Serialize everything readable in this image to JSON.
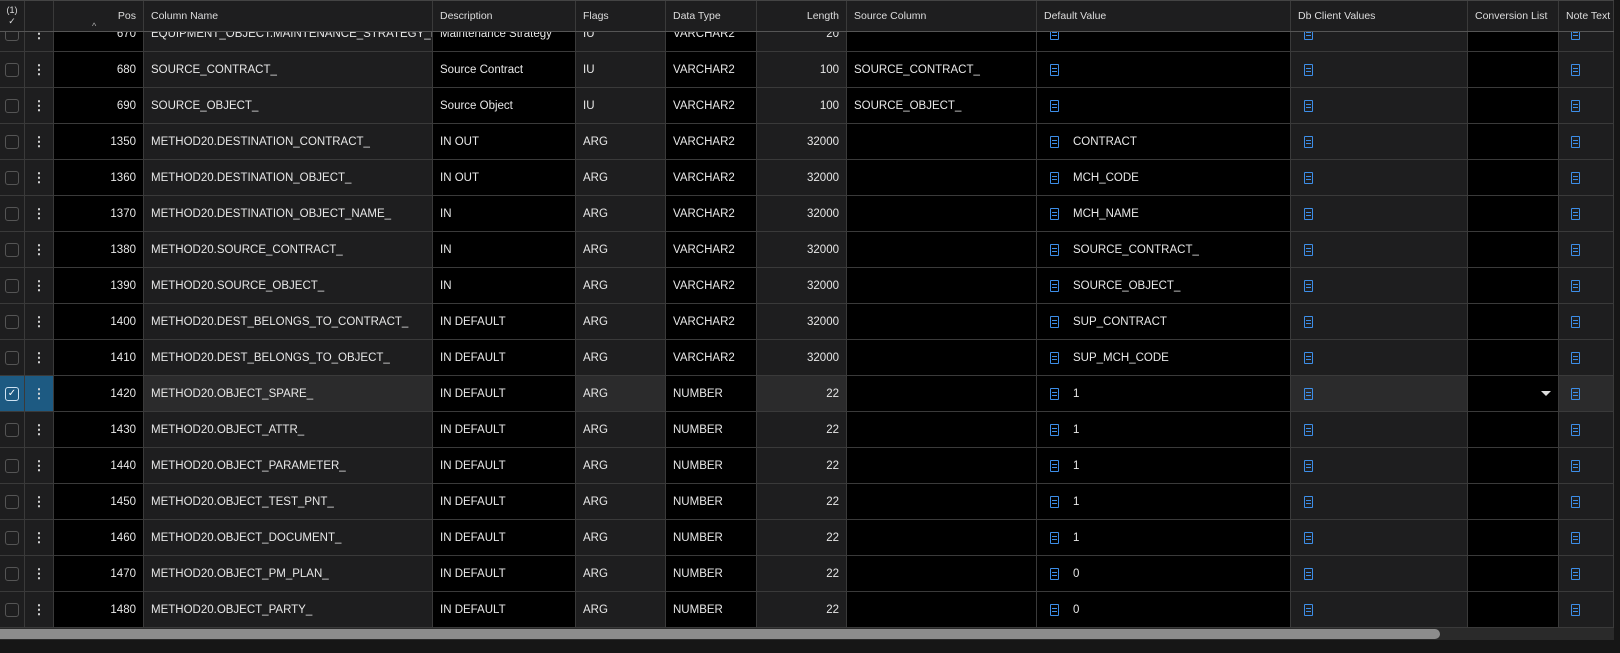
{
  "header": {
    "selected_count": "(1)",
    "check": "✓",
    "sort_indicator": "^",
    "columns": [
      "Pos",
      "Column Name",
      "Description",
      "Flags",
      "Data Type",
      "Length",
      "Source Column",
      "Default Value",
      "Db Client Values",
      "Conversion List",
      "Note Text"
    ]
  },
  "icon_color": "#3d8ee8",
  "selected_color": "#1d5a82",
  "rows": [
    {
      "pos": "670",
      "name": "EQUIPMENT_OBJECT.MAINTENANCE_STRATEGY_ID",
      "desc": "Maintenance Strategy",
      "flags": "IU",
      "type": "VARCHAR2",
      "len": "20",
      "src": "",
      "def": "",
      "selected": false
    },
    {
      "pos": "680",
      "name": "SOURCE_CONTRACT_",
      "desc": "Source Contract",
      "flags": "IU",
      "type": "VARCHAR2",
      "len": "100",
      "src": "SOURCE_CONTRACT_",
      "def": "",
      "selected": false
    },
    {
      "pos": "690",
      "name": "SOURCE_OBJECT_",
      "desc": "Source Object",
      "flags": "IU",
      "type": "VARCHAR2",
      "len": "100",
      "src": "SOURCE_OBJECT_",
      "def": "",
      "selected": false
    },
    {
      "pos": "1350",
      "name": "METHOD20.DESTINATION_CONTRACT_",
      "desc": "IN OUT",
      "flags": "ARG",
      "type": "VARCHAR2",
      "len": "32000",
      "src": "",
      "def": "CONTRACT",
      "selected": false
    },
    {
      "pos": "1360",
      "name": "METHOD20.DESTINATION_OBJECT_",
      "desc": "IN OUT",
      "flags": "ARG",
      "type": "VARCHAR2",
      "len": "32000",
      "src": "",
      "def": "MCH_CODE",
      "selected": false
    },
    {
      "pos": "1370",
      "name": "METHOD20.DESTINATION_OBJECT_NAME_",
      "desc": "IN",
      "flags": "ARG",
      "type": "VARCHAR2",
      "len": "32000",
      "src": "",
      "def": "MCH_NAME",
      "selected": false
    },
    {
      "pos": "1380",
      "name": "METHOD20.SOURCE_CONTRACT_",
      "desc": "IN",
      "flags": "ARG",
      "type": "VARCHAR2",
      "len": "32000",
      "src": "",
      "def": "SOURCE_CONTRACT_",
      "selected": false
    },
    {
      "pos": "1390",
      "name": "METHOD20.SOURCE_OBJECT_",
      "desc": "IN",
      "flags": "ARG",
      "type": "VARCHAR2",
      "len": "32000",
      "src": "",
      "def": "SOURCE_OBJECT_",
      "selected": false
    },
    {
      "pos": "1400",
      "name": "METHOD20.DEST_BELONGS_TO_CONTRACT_",
      "desc": "IN DEFAULT",
      "flags": "ARG",
      "type": "VARCHAR2",
      "len": "32000",
      "src": "",
      "def": "SUP_CONTRACT",
      "selected": false
    },
    {
      "pos": "1410",
      "name": "METHOD20.DEST_BELONGS_TO_OBJECT_",
      "desc": "IN DEFAULT",
      "flags": "ARG",
      "type": "VARCHAR2",
      "len": "32000",
      "src": "",
      "def": "SUP_MCH_CODE",
      "selected": false
    },
    {
      "pos": "1420",
      "name": "METHOD20.OBJECT_SPARE_",
      "desc": "IN DEFAULT",
      "flags": "ARG",
      "type": "NUMBER",
      "len": "22",
      "src": "",
      "def": "1",
      "selected": true
    },
    {
      "pos": "1430",
      "name": "METHOD20.OBJECT_ATTR_",
      "desc": "IN DEFAULT",
      "flags": "ARG",
      "type": "NUMBER",
      "len": "22",
      "src": "",
      "def": "1",
      "selected": false
    },
    {
      "pos": "1440",
      "name": "METHOD20.OBJECT_PARAMETER_",
      "desc": "IN DEFAULT",
      "flags": "ARG",
      "type": "NUMBER",
      "len": "22",
      "src": "",
      "def": "1",
      "selected": false
    },
    {
      "pos": "1450",
      "name": "METHOD20.OBJECT_TEST_PNT_",
      "desc": "IN DEFAULT",
      "flags": "ARG",
      "type": "NUMBER",
      "len": "22",
      "src": "",
      "def": "1",
      "selected": false
    },
    {
      "pos": "1460",
      "name": "METHOD20.OBJECT_DOCUMENT_",
      "desc": "IN DEFAULT",
      "flags": "ARG",
      "type": "NUMBER",
      "len": "22",
      "src": "",
      "def": "1",
      "selected": false
    },
    {
      "pos": "1470",
      "name": "METHOD20.OBJECT_PM_PLAN_",
      "desc": "IN DEFAULT",
      "flags": "ARG",
      "type": "NUMBER",
      "len": "22",
      "src": "",
      "def": "0",
      "selected": false
    },
    {
      "pos": "1480",
      "name": "METHOD20.OBJECT_PARTY_",
      "desc": "IN DEFAULT",
      "flags": "ARG",
      "type": "NUMBER",
      "len": "22",
      "src": "",
      "def": "0",
      "selected": false
    }
  ]
}
